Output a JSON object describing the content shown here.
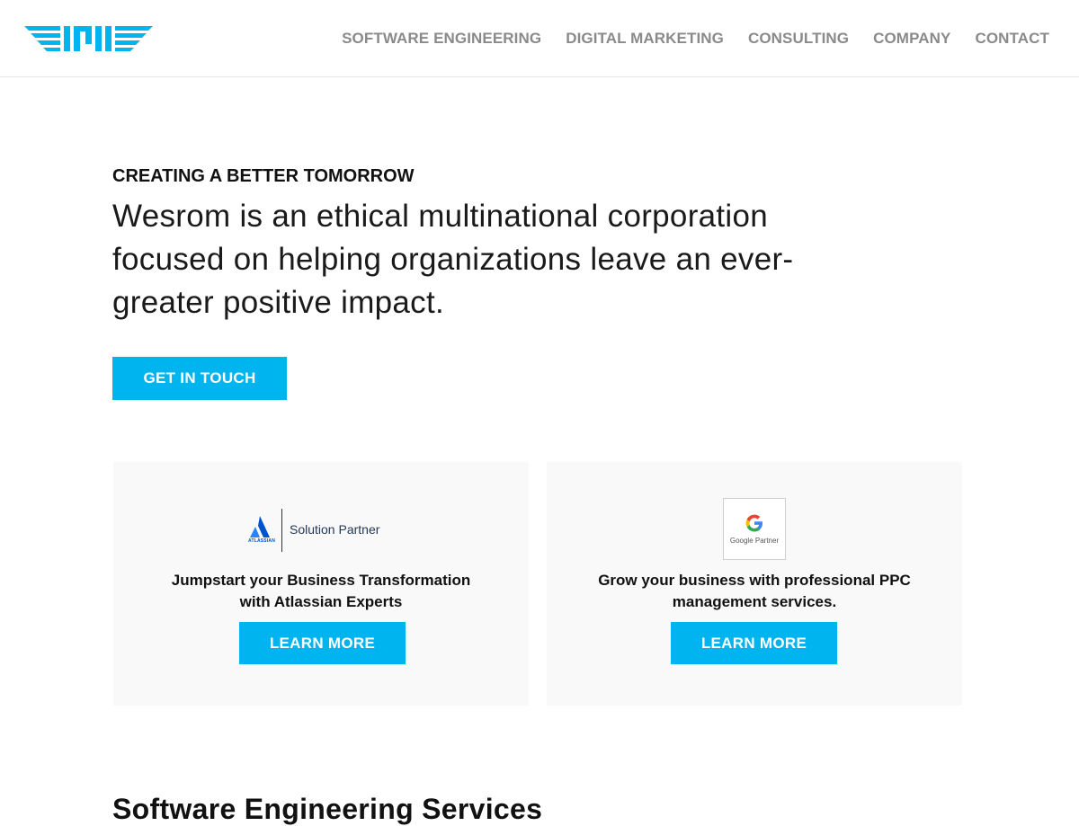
{
  "brand": {
    "accent": "#00b4ef",
    "nav_color": "#8a8a8a"
  },
  "nav": {
    "items": [
      {
        "label": "SOFTWARE ENGINEERING"
      },
      {
        "label": "DIGITAL MARKETING"
      },
      {
        "label": "CONSULTING"
      },
      {
        "label": "COMPANY"
      },
      {
        "label": "CONTACT"
      }
    ]
  },
  "hero": {
    "eyebrow": "CREATING A BETTER TOMORROW",
    "headline": "Wesrom is an ethical multinational corporation focused on helping organizations leave an ever-greater positive impact.",
    "cta_label": "GET IN TOUCH"
  },
  "cards": [
    {
      "badge_wordmark": "ATLASSIAN",
      "badge_label": "Solution Partner",
      "title": "Jumpstart your Business Transformation with Atlassian Experts",
      "button_label": "LEARN MORE"
    },
    {
      "badge_label": "Google Partner",
      "title": "Grow your business with professional PPC management services.",
      "button_label": "LEARN MORE"
    }
  ],
  "next_section": {
    "heading": "Software Engineering Services"
  }
}
